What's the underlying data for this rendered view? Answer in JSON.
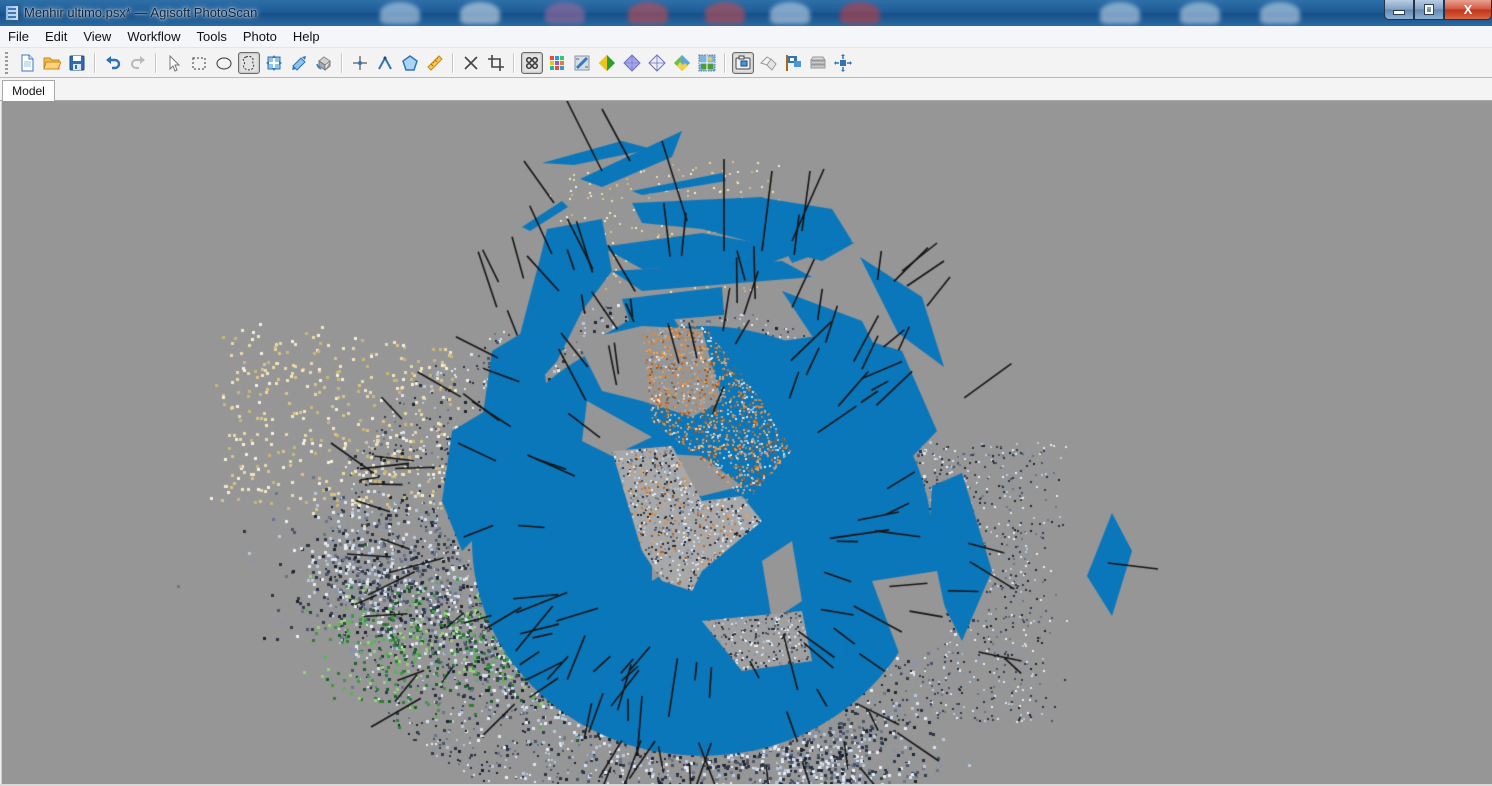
{
  "window": {
    "title": "Menhir ultimo.psx* — Agisoft PhotoScan",
    "app_icon": "film-strip-icon",
    "controls": {
      "minimize": {
        "label": "",
        "icon": "minimize-icon"
      },
      "maximize": {
        "label": "",
        "icon": "restore-icon"
      },
      "close": {
        "label": "X",
        "icon": "close-icon"
      }
    }
  },
  "menubar": {
    "items": [
      {
        "label": "File"
      },
      {
        "label": "Edit"
      },
      {
        "label": "View"
      },
      {
        "label": "Workflow"
      },
      {
        "label": "Tools"
      },
      {
        "label": "Photo"
      },
      {
        "label": "Help"
      }
    ]
  },
  "toolbar": {
    "groups": [
      [
        {
          "name": "new-button",
          "icon": "new-document-icon",
          "tooltip": "New"
        },
        {
          "name": "open-button",
          "icon": "open-folder-icon",
          "tooltip": "Open"
        },
        {
          "name": "save-button",
          "icon": "save-disk-icon",
          "tooltip": "Save"
        }
      ],
      [
        {
          "name": "undo-button",
          "icon": "undo-icon",
          "tooltip": "Undo"
        },
        {
          "name": "redo-button",
          "icon": "redo-icon",
          "tooltip": "Redo",
          "disabled": true
        }
      ],
      [
        {
          "name": "navigation-button",
          "icon": "cursor-arrow-icon",
          "tooltip": "Navigation"
        },
        {
          "name": "rectangle-selection-button",
          "icon": "rectangle-selection-icon",
          "tooltip": "Rectangle Selection"
        },
        {
          "name": "circle-selection-button",
          "icon": "circle-selection-icon",
          "tooltip": "Circle Selection"
        },
        {
          "name": "free-form-selection-button",
          "icon": "free-form-selection-icon",
          "tooltip": "Free-Form Selection",
          "active": true
        },
        {
          "name": "move-region-button",
          "icon": "move-region-icon",
          "tooltip": "Move Region"
        },
        {
          "name": "resize-region-button",
          "icon": "resize-region-icon",
          "tooltip": "Resize Region"
        },
        {
          "name": "rotate-region-button",
          "icon": "rotate-region-icon",
          "tooltip": "Rotate Region"
        }
      ],
      [
        {
          "name": "draw-point-button",
          "icon": "draw-point-icon",
          "tooltip": "Draw Point"
        },
        {
          "name": "draw-polyline-button",
          "icon": "draw-polyline-icon",
          "tooltip": "Draw Polyline"
        },
        {
          "name": "draw-polygon-button",
          "icon": "draw-polygon-icon",
          "tooltip": "Draw Polygon"
        },
        {
          "name": "ruler-button",
          "icon": "ruler-icon",
          "tooltip": "Ruler"
        }
      ],
      [
        {
          "name": "delete-selection-button",
          "icon": "delete-x-icon",
          "tooltip": "Delete Selection"
        },
        {
          "name": "crop-selection-button",
          "icon": "crop-icon",
          "tooltip": "Crop Selection"
        }
      ],
      [
        {
          "name": "point-cloud-button",
          "icon": "point-cloud-icon",
          "tooltip": "Point Cloud",
          "active": true
        },
        {
          "name": "point-cloud-variance-button",
          "icon": "point-cloud-variance-icon",
          "tooltip": "Point Cloud Variance"
        },
        {
          "name": "dense-cloud-button",
          "icon": "dense-cloud-icon",
          "tooltip": "Dense Cloud"
        },
        {
          "name": "shaded-model-button",
          "icon": "shaded-model-icon",
          "tooltip": "Shaded"
        },
        {
          "name": "solid-model-button",
          "icon": "solid-model-icon",
          "tooltip": "Solid"
        },
        {
          "name": "wireframe-model-button",
          "icon": "wireframe-model-icon",
          "tooltip": "Wireframe"
        },
        {
          "name": "textured-model-button",
          "icon": "textured-model-icon",
          "tooltip": "Textured"
        },
        {
          "name": "tiled-model-button",
          "icon": "tiled-model-icon",
          "tooltip": "Tiled Model"
        }
      ],
      [
        {
          "name": "show-cameras-button",
          "icon": "camera-icon",
          "tooltip": "Show Cameras",
          "active": true
        },
        {
          "name": "show-shapes-button",
          "icon": "shapes-icon",
          "tooltip": "Show Shapes"
        },
        {
          "name": "show-markers-button",
          "icon": "marker-flag-icon",
          "tooltip": "Show Markers"
        },
        {
          "name": "show-region-button",
          "icon": "region-layers-icon",
          "tooltip": "Show Region"
        },
        {
          "name": "reset-view-button",
          "icon": "reset-view-icon",
          "tooltip": "Reset View"
        }
      ]
    ]
  },
  "tabs": [
    {
      "label": "Model",
      "active": true
    }
  ],
  "viewport": {
    "view": "Model",
    "content": "sparse point cloud with aligned camera planes",
    "colors": {
      "background": "#969696",
      "camera_plane": "#0a77bb",
      "camera_axis": "#141414"
    }
  }
}
